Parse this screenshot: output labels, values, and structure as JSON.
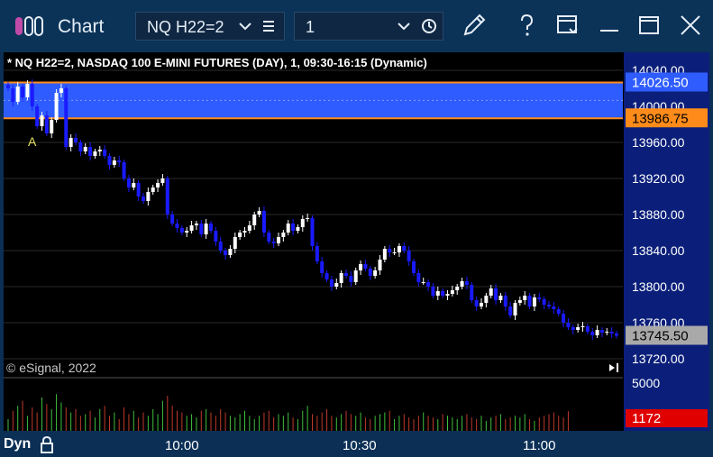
{
  "window": {
    "title": "Chart",
    "symbol_value": "NQ H22=2",
    "interval_value": "1"
  },
  "chart": {
    "title": "* NQ H22=2, NASDAQ 100 E-MINI FUTURES (DAY), 1, 09:30-16:15 (Dynamic)",
    "copyright": "© eSignal, 2022",
    "marker_label": "A",
    "band_high_label": "14026.50",
    "band_low_label": "13986.75",
    "last_price_label": "13745.50",
    "volume_scale_label": "5000",
    "last_volume_label": "1172",
    "price_ticks": [
      "14040.00",
      "14000.00",
      "13960.00",
      "13920.00",
      "13880.00",
      "13840.00",
      "13800.00",
      "13760.00",
      "13720.00"
    ],
    "time_ticks": [
      "10:00",
      "10:30",
      "11:00"
    ],
    "dyn_label": "Dyn"
  },
  "colors": {
    "band": "#2f5cff",
    "band_border": "#ff8c1a",
    "down_candle": "#1a1aff",
    "up_candle": "#ffffff",
    "vol_up": "#3fbf3f",
    "vol_down": "#c0392b",
    "last_price_bg": "#a9a9a9",
    "last_volume_bg": "#e00000",
    "axis_bg": "#0b1f7a"
  },
  "chart_data": {
    "type": "candlestick",
    "ylim": [
      13700,
      14060
    ],
    "close": [
      14020,
      14005,
      14022,
      14010,
      14025,
      14000,
      13978,
      13990,
      13970,
      13985,
      14015,
      14020,
      13955,
      13965,
      13960,
      13950,
      13955,
      13945,
      13950,
      13952,
      13945,
      13935,
      13940,
      13938,
      13920,
      13910,
      13915,
      13900,
      13895,
      13905,
      13910,
      13915,
      13920,
      13880,
      13870,
      13865,
      13860,
      13862,
      13868,
      13870,
      13858,
      13870,
      13862,
      13850,
      13840,
      13835,
      13842,
      13855,
      13860,
      13862,
      13868,
      13880,
      13884,
      13860,
      13850,
      13848,
      13855,
      13860,
      13870,
      13862,
      13866,
      13875,
      13876,
      13845,
      13828,
      13815,
      13808,
      13800,
      13804,
      13815,
      13812,
      13805,
      13818,
      13825,
      13820,
      13812,
      13818,
      13830,
      13842,
      13838,
      13838,
      13845,
      13840,
      13828,
      13815,
      13805,
      13805,
      13800,
      13790,
      13795,
      13790,
      13792,
      13796,
      13800,
      13806,
      13802,
      13785,
      13778,
      13782,
      13790,
      13798,
      13785,
      13790,
      13778,
      13768,
      13782,
      13785,
      13790,
      13778,
      13788,
      13786,
      13780,
      13778,
      13775,
      13770,
      13760,
      13755,
      13752,
      13755,
      13756,
      13750,
      13746,
      13752,
      13749,
      13750,
      13748,
      13745.5
    ],
    "volume": [
      700,
      1200,
      1500,
      1800,
      900,
      1400,
      1100,
      2000,
      1600,
      1300,
      2200,
      1700,
      1400,
      1100,
      1300,
      900,
      1000,
      1200,
      800,
      1300,
      1500,
      900,
      1100,
      700,
      1400,
      1000,
      1200,
      800,
      1100,
      900,
      1300,
      1000,
      1800,
      2100,
      1500,
      1200,
      1100,
      900,
      1000,
      800,
      1200,
      1300,
      1100,
      900,
      1300,
      1100,
      900,
      800,
      1000,
      1200,
      900,
      700,
      900,
      1100,
      1200,
      800,
      1000,
      900,
      1100,
      800,
      700,
      1200,
      1500,
      1000,
      900,
      1100,
      1300,
      900,
      800,
      1000,
      1200,
      1000,
      900,
      1100,
      800,
      700,
      900,
      1000,
      1100,
      1200,
      700,
      900,
      1000,
      800,
      700,
      900,
      1100,
      900,
      800,
      700,
      1000,
      900,
      800,
      700,
      900,
      1000,
      800,
      700,
      900,
      600,
      800,
      900,
      1000,
      700,
      800,
      900,
      800,
      1000,
      700,
      600,
      800,
      900,
      1000,
      1100,
      900,
      800,
      1172
    ]
  }
}
